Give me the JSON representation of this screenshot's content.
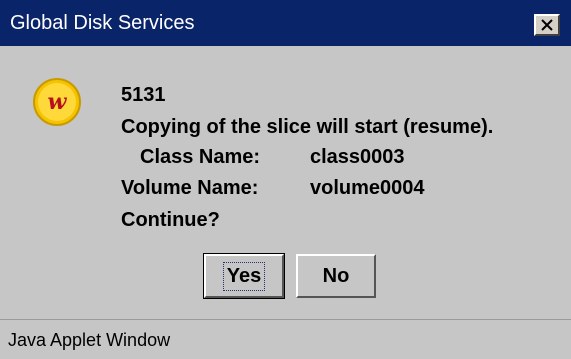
{
  "window": {
    "title": "Global Disk Services"
  },
  "dialog": {
    "code": "5131",
    "message": "Copying of the slice will start (resume).",
    "class_label": "Class Name:",
    "class_value": "class0003",
    "volume_label": "Volume Name:",
    "volume_value": "volume0004",
    "prompt": "Continue?"
  },
  "buttons": {
    "yes": "Yes",
    "no": "No"
  },
  "status": {
    "text": "Java Applet Window"
  },
  "icons": {
    "app": "w-logo-icon",
    "close": "close-icon"
  },
  "colors": {
    "titlebar": "#0a246a",
    "background": "#c6c6c6",
    "icon_red": "#b5121b",
    "icon_yellow": "#f5c400"
  }
}
